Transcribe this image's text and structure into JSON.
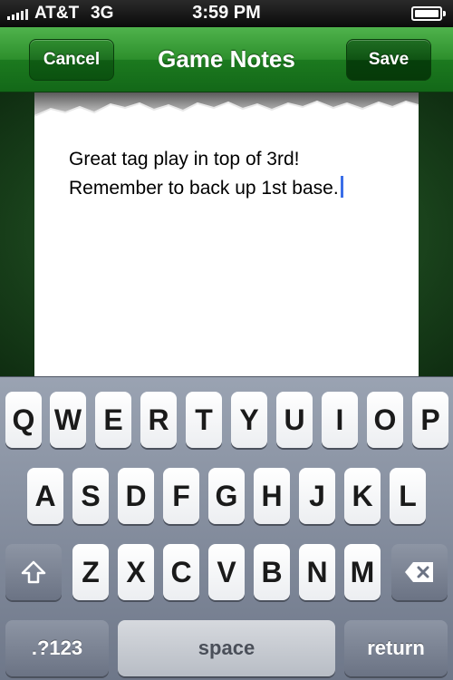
{
  "status_bar": {
    "carrier": "AT&T",
    "network": "3G",
    "time": "3:59 PM"
  },
  "nav": {
    "title": "Game Notes",
    "cancel_label": "Cancel",
    "save_label": "Save"
  },
  "note": {
    "lines": [
      "Great tag play in top of 3rd!",
      "Remember to back up 1st base."
    ]
  },
  "keyboard": {
    "row1": [
      "Q",
      "W",
      "E",
      "R",
      "T",
      "Y",
      "U",
      "I",
      "O",
      "P"
    ],
    "row2": [
      "A",
      "S",
      "D",
      "F",
      "G",
      "H",
      "J",
      "K",
      "L"
    ],
    "row3": [
      "Z",
      "X",
      "C",
      "V",
      "B",
      "N",
      "M"
    ],
    "numbers_label": ".?123",
    "space_label": "space",
    "return_label": "return"
  },
  "colors": {
    "nav_green": "#2d8f2c",
    "caret_blue": "#3a6ee8"
  }
}
